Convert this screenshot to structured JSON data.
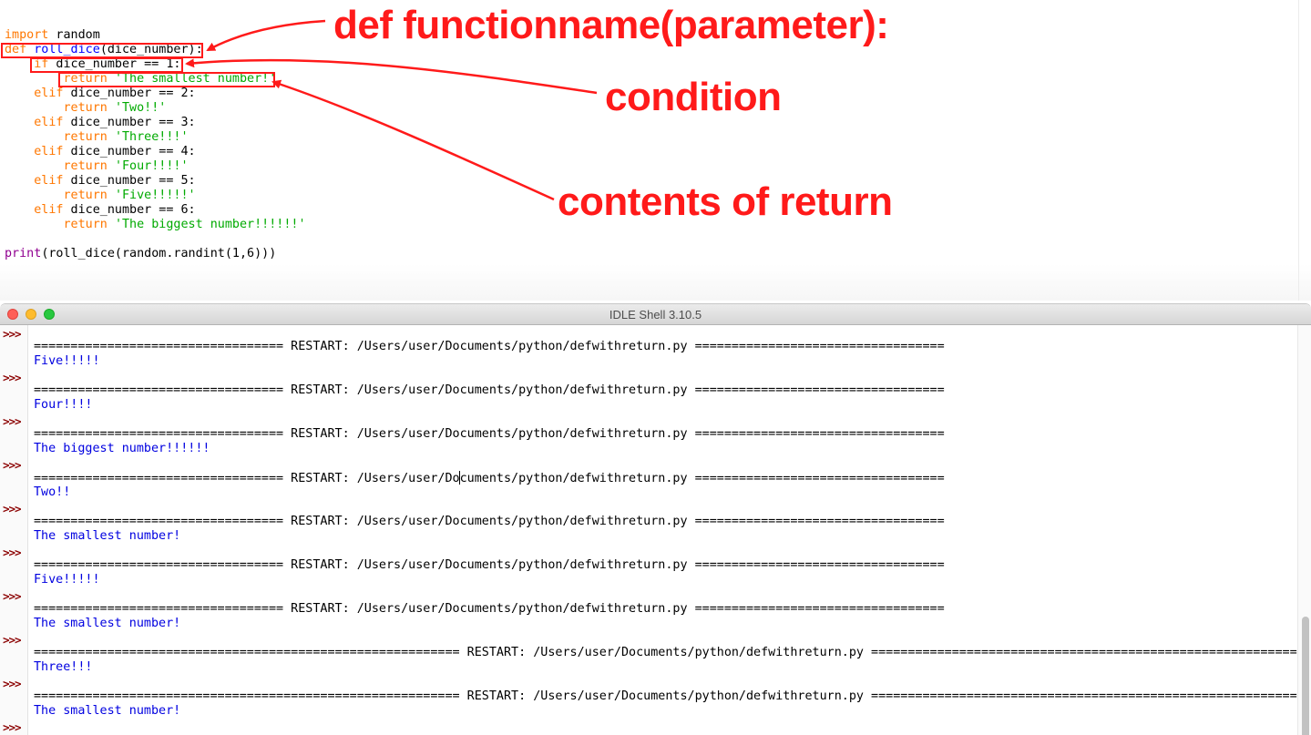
{
  "editor": {
    "lines": [
      [
        {
          "t": "import",
          "c": "kw"
        },
        {
          "t": " random",
          "c": ""
        }
      ],
      [
        {
          "t": "def",
          "c": "kw"
        },
        {
          "t": " ",
          "c": ""
        },
        {
          "t": "roll_dice",
          "c": "fn"
        },
        {
          "t": "(dice_number):",
          "c": ""
        }
      ],
      [
        {
          "t": "    ",
          "c": ""
        },
        {
          "t": "if",
          "c": "kw"
        },
        {
          "t": " dice_number == 1:",
          "c": ""
        }
      ],
      [
        {
          "t": "        ",
          "c": ""
        },
        {
          "t": "return",
          "c": "kw"
        },
        {
          "t": " ",
          "c": ""
        },
        {
          "t": "'The smallest number!'",
          "c": "str"
        }
      ],
      [
        {
          "t": "    ",
          "c": ""
        },
        {
          "t": "elif",
          "c": "kw"
        },
        {
          "t": " dice_number == 2:",
          "c": ""
        }
      ],
      [
        {
          "t": "        ",
          "c": ""
        },
        {
          "t": "return",
          "c": "kw"
        },
        {
          "t": " ",
          "c": ""
        },
        {
          "t": "'Two!!'",
          "c": "str"
        }
      ],
      [
        {
          "t": "    ",
          "c": ""
        },
        {
          "t": "elif",
          "c": "kw"
        },
        {
          "t": " dice_number == 3:",
          "c": ""
        }
      ],
      [
        {
          "t": "        ",
          "c": ""
        },
        {
          "t": "return",
          "c": "kw"
        },
        {
          "t": " ",
          "c": ""
        },
        {
          "t": "'Three!!!'",
          "c": "str"
        }
      ],
      [
        {
          "t": "    ",
          "c": ""
        },
        {
          "t": "elif",
          "c": "kw"
        },
        {
          "t": " dice_number == 4:",
          "c": ""
        }
      ],
      [
        {
          "t": "        ",
          "c": ""
        },
        {
          "t": "return",
          "c": "kw"
        },
        {
          "t": " ",
          "c": ""
        },
        {
          "t": "'Four!!!!'",
          "c": "str"
        }
      ],
      [
        {
          "t": "    ",
          "c": ""
        },
        {
          "t": "elif",
          "c": "kw"
        },
        {
          "t": " dice_number == 5:",
          "c": ""
        }
      ],
      [
        {
          "t": "        ",
          "c": ""
        },
        {
          "t": "return",
          "c": "kw"
        },
        {
          "t": " ",
          "c": ""
        },
        {
          "t": "'Five!!!!!'",
          "c": "str"
        }
      ],
      [
        {
          "t": "    ",
          "c": ""
        },
        {
          "t": "elif",
          "c": "kw"
        },
        {
          "t": " dice_number == 6:",
          "c": ""
        }
      ],
      [
        {
          "t": "        ",
          "c": ""
        },
        {
          "t": "return",
          "c": "kw"
        },
        {
          "t": " ",
          "c": ""
        },
        {
          "t": "'The biggest number!!!!!!'",
          "c": "str"
        }
      ],
      [],
      [
        {
          "t": "print",
          "c": "bi"
        },
        {
          "t": "(roll_dice(random.randint(1,6)))",
          "c": ""
        }
      ]
    ]
  },
  "annotations": {
    "def_label": "def functionname(parameter):",
    "condition_label": "condition",
    "return_label": "contents of return",
    "color": "#ff1a1a"
  },
  "shell": {
    "title": "IDLE Shell 3.10.5",
    "prompt": ">>>",
    "restart_text": "RESTART: /Users/user/Documents/python/defwithreturn.py",
    "caret_after": "RESTART: /Users/user/Do",
    "entries": [
      {
        "result": "Five!!!!!",
        "wide": false,
        "caret": false
      },
      {
        "result": "Four!!!!",
        "wide": false,
        "caret": false
      },
      {
        "result": "The biggest number!!!!!!",
        "wide": false,
        "caret": false
      },
      {
        "result": "Two!!",
        "wide": false,
        "caret": true
      },
      {
        "result": "The smallest number!",
        "wide": false,
        "caret": false
      },
      {
        "result": "Five!!!!!",
        "wide": false,
        "caret": false
      },
      {
        "result": "The smallest number!",
        "wide": false,
        "caret": false
      },
      {
        "result": "Three!!!",
        "wide": true,
        "caret": false
      },
      {
        "result": "The smallest number!",
        "wide": true,
        "caret": false
      }
    ],
    "separator_count_short": 34,
    "separator_count_wide": 58
  },
  "colors": {
    "keyword": "#ff7700",
    "definition": "#0000ff",
    "string": "#00aa00",
    "builtin": "#900090",
    "shell_output": "#0000e0",
    "prompt": "#8b0000"
  }
}
